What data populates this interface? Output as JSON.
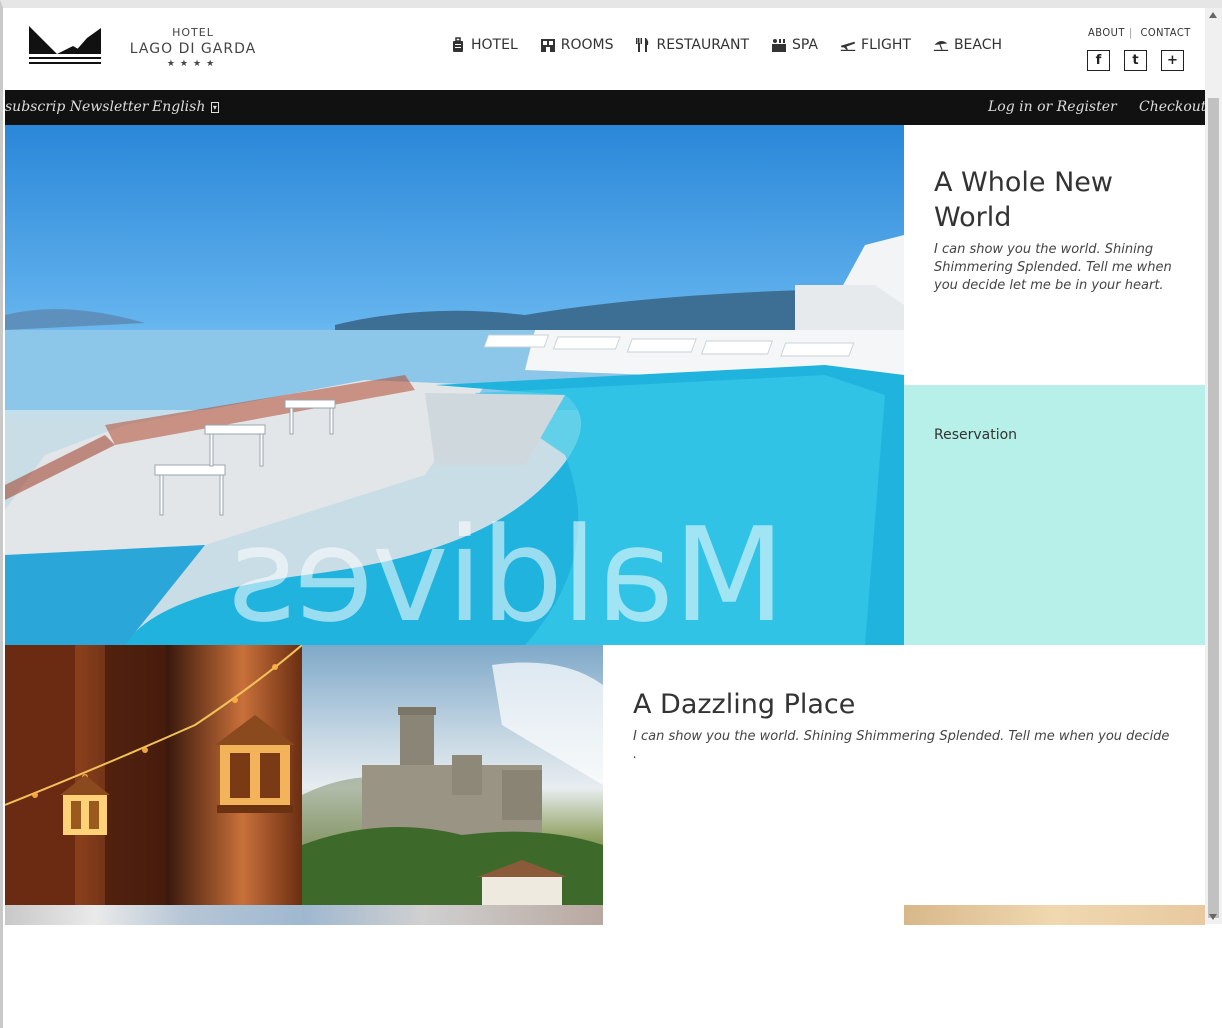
{
  "logo": {
    "hotel": "HOTEL",
    "name": "LAGO DI GARDA",
    "stars": "★★★★"
  },
  "nav": [
    {
      "label": "HOTEL",
      "icon": "luggage-icon"
    },
    {
      "label": "ROOMS",
      "icon": "rooms-icon"
    },
    {
      "label": "RESTAURANT",
      "icon": "cutlery-icon"
    },
    {
      "label": "SPA",
      "icon": "spa-icon"
    },
    {
      "label": "FLIGHT",
      "icon": "plane-icon"
    },
    {
      "label": "BEACH",
      "icon": "umbrella-icon"
    }
  ],
  "top_links": {
    "about": "ABOUT",
    "contact": "CONTACT"
  },
  "social": {
    "facebook": "f",
    "twitter": "t",
    "plus": "+"
  },
  "topbar": {
    "newsletter": "subscrip Newsletter",
    "language": "English",
    "login": "Log in or Register",
    "checkout": "Checkout"
  },
  "hero": {
    "overlay_text": "Maldives"
  },
  "panel1": {
    "title": "A Whole New World",
    "body": "I can show you the world. Shining Shimmering Splended. Tell me when you decide let me be in your heart."
  },
  "panel2": {
    "label": "Reservation"
  },
  "panel3": {
    "title": "A Dazzling Place",
    "body": "I can show you the world. Shining Shimmering Splended. Tell me when you decide ."
  },
  "colors": {
    "topbar": "#111111",
    "reservation_bg": "#b7f0e8",
    "pool": "#2ab8e0"
  }
}
